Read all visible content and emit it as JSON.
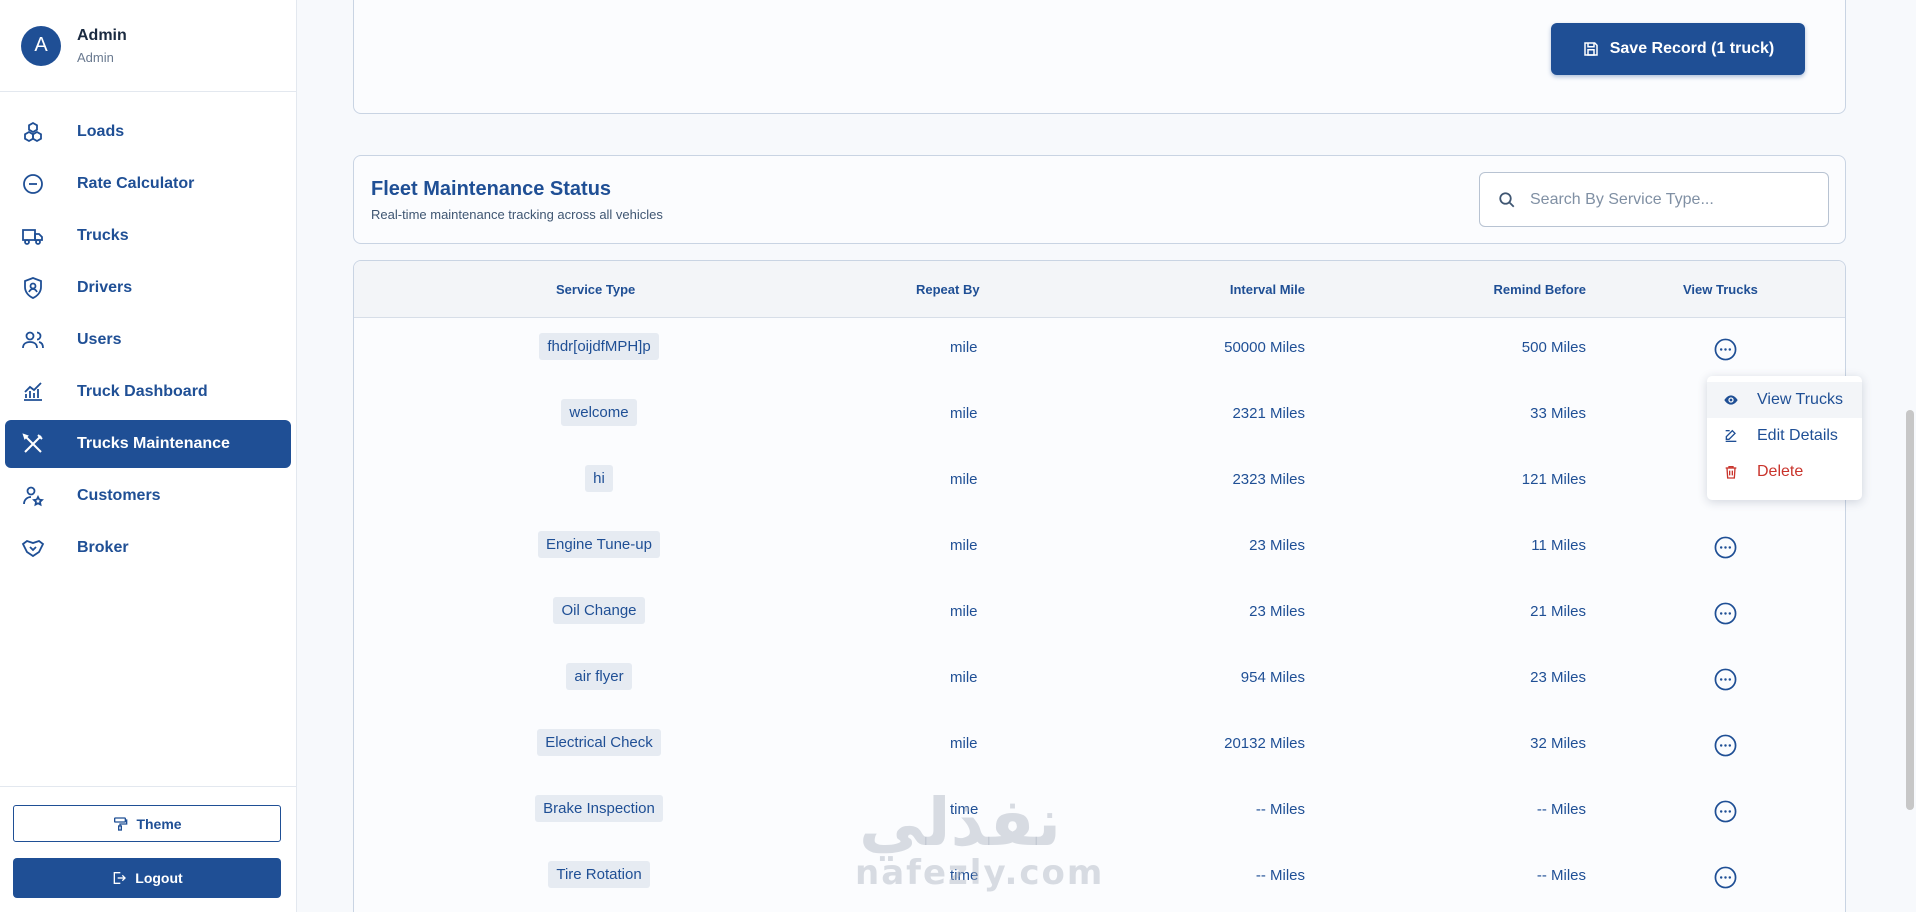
{
  "profile": {
    "initial": "A",
    "name": "Admin",
    "role": "Admin"
  },
  "sidebar": {
    "items": [
      {
        "label": "Loads",
        "icon": "boxes-icon"
      },
      {
        "label": "Rate Calculator",
        "icon": "minus-circle-icon"
      },
      {
        "label": "Trucks",
        "icon": "truck-icon"
      },
      {
        "label": "Drivers",
        "icon": "shield-user-icon"
      },
      {
        "label": "Users",
        "icon": "users-icon"
      },
      {
        "label": "Truck Dashboard",
        "icon": "chart-icon"
      },
      {
        "label": "Trucks Maintenance",
        "icon": "tools-icon",
        "active": true
      },
      {
        "label": "Customers",
        "icon": "user-star-icon"
      },
      {
        "label": "Broker",
        "icon": "handshake-icon"
      }
    ],
    "theme_label": "Theme",
    "logout_label": "Logout"
  },
  "toolbar": {
    "save_label": "Save Record (1 truck)"
  },
  "status": {
    "title": "Fleet Maintenance Status",
    "subtitle": "Real-time maintenance tracking across all vehicles",
    "search_placeholder": "Search By Service Type..."
  },
  "table": {
    "headers": {
      "service": "Service Type",
      "repeat": "Repeat By",
      "interval": "Interval Mile",
      "remind": "Remind Before",
      "view": "View Trucks"
    },
    "rows": [
      {
        "service": "fhdr[oijdfMPH]p",
        "repeat": "mile",
        "interval": "50000 Miles",
        "remind": "500 Miles"
      },
      {
        "service": "welcome",
        "repeat": "mile",
        "interval": "2321 Miles",
        "remind": "33 Miles"
      },
      {
        "service": "hi",
        "repeat": "mile",
        "interval": "2323 Miles",
        "remind": "121 Miles"
      },
      {
        "service": "Engine Tune-up",
        "repeat": "mile",
        "interval": "23 Miles",
        "remind": "11 Miles"
      },
      {
        "service": "Oil Change",
        "repeat": "mile",
        "interval": "23 Miles",
        "remind": "21 Miles"
      },
      {
        "service": "air flyer",
        "repeat": "mile",
        "interval": "954 Miles",
        "remind": "23 Miles"
      },
      {
        "service": "Electrical Check",
        "repeat": "mile",
        "interval": "20132 Miles",
        "remind": "32 Miles"
      },
      {
        "service": "Brake Inspection",
        "repeat": "time",
        "interval": "-- Miles",
        "remind": "-- Miles"
      },
      {
        "service": "Tire Rotation",
        "repeat": "time",
        "interval": "-- Miles",
        "remind": "-- Miles"
      }
    ]
  },
  "menu": {
    "view": "View Trucks",
    "edit": "Edit Details",
    "delete": "Delete"
  },
  "watermark": {
    "arabic": "نفذلي",
    "latin": "nafezly.com"
  },
  "colors": {
    "primary": "#1f4f95",
    "danger": "#c9342c",
    "border": "#c9d4e3"
  }
}
